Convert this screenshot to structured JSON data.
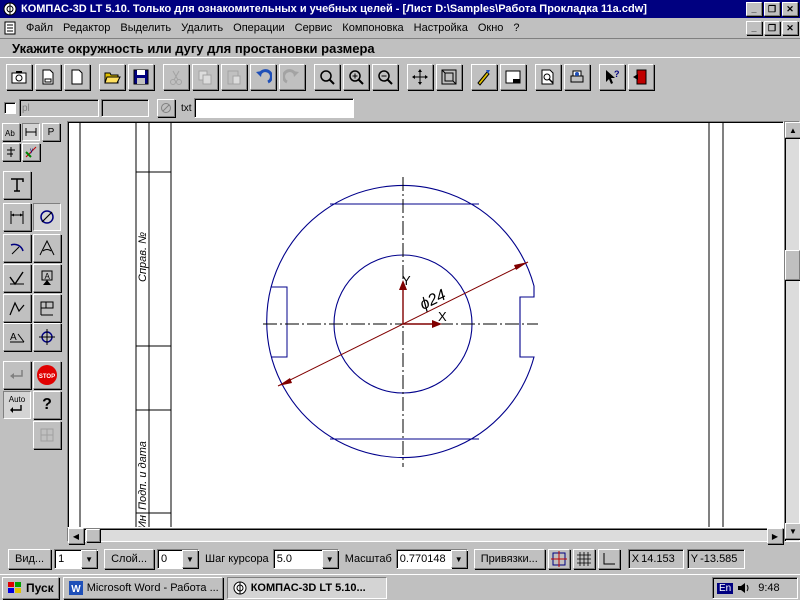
{
  "window": {
    "title": "КОМПАС-3D LT 5.10. Только для ознакомительных и учебных целей - [Лист D:\\Samples\\Работа Прокладка 11а.cdw]"
  },
  "menu": {
    "items": [
      "Файл",
      "Редактор",
      "Выделить",
      "Удалить",
      "Операции",
      "Сервис",
      "Компоновка",
      "Настройка",
      "Окно",
      "?"
    ]
  },
  "prompt": {
    "text": "Укажите окружность или дугу для простановки размера"
  },
  "propline": {
    "pl_label": "pl",
    "txt_label": "txt"
  },
  "palette": {
    "tab_p": "P",
    "auto_label": "Auto",
    "help_label": "?",
    "stop_label": "STOP"
  },
  "drawing": {
    "stamp_text_1": "Справ. №",
    "stamp_text_2": "Подп. и дата",
    "stamp_text_3": "Ин",
    "dimension_text": "ϕ24",
    "axis_x": "X",
    "axis_y": "Y",
    "colors": {
      "contour": "#00008b",
      "dimension": "#800000",
      "axis": "#000000"
    }
  },
  "status": {
    "view_button": "Вид...",
    "view_value": "1",
    "layer_button": "Слой...",
    "layer_value": "0",
    "step_label": "Шаг курсора",
    "step_value": "5.0",
    "scale_label": "Масштаб",
    "scale_value": "0.770148",
    "snap_button": "Привязки...",
    "x_label": "X",
    "x_value": "14.153",
    "y_label": "Y",
    "y_value": "-13.585"
  },
  "taskbar": {
    "start_label": "Пуск",
    "task_word": "Microsoft Word - Работа ...",
    "task_kompas": "КОМПАС-3D LT 5.10...",
    "lang": "En",
    "clock": "9:48"
  }
}
